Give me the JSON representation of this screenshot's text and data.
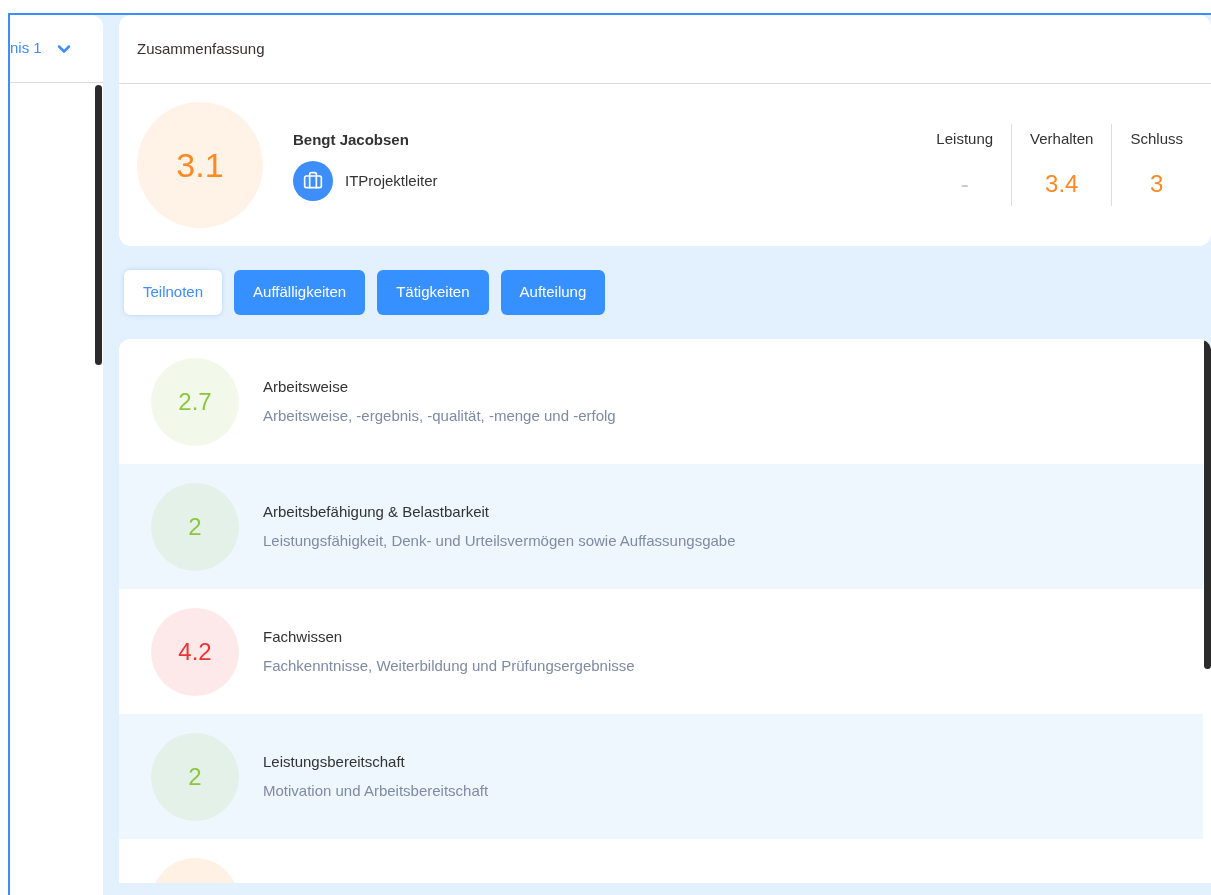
{
  "sidebar": {
    "dropdown_label": "nis 1"
  },
  "summary": {
    "title": "Zusammenfassung",
    "overall": {
      "score": "3.1",
      "color": "#fb8a24"
    },
    "name": "Bengt Jacobsen",
    "role": "ITProjektleiter",
    "grades": [
      {
        "label": "Leistung",
        "value": "-",
        "color": "#c8c8c8"
      },
      {
        "label": "Verhalten",
        "value": "3.4",
        "color": "#fb8a24"
      },
      {
        "label": "Schluss",
        "value": "3",
        "color": "#fb8a24"
      }
    ]
  },
  "tabs": [
    {
      "label": "Teilnoten",
      "selected": true
    },
    {
      "label": "Auffälligkeiten",
      "selected": false
    },
    {
      "label": "Tätigkeiten",
      "selected": false
    },
    {
      "label": "Aufteilung",
      "selected": false
    }
  ],
  "items": [
    {
      "score": "2.7",
      "color": "#8cc63f",
      "title": "Arbeitsweise",
      "subtitle": "Arbeitsweise, -ergebnis, -qualität, -menge und -erfolg"
    },
    {
      "score": "2",
      "color": "#8cc63f",
      "title": "Arbeitsbefähigung & Belastbarkeit",
      "subtitle": "Leistungsfähigkeit, Denk- und Urteilsvermögen sowie Auffassungsgabe"
    },
    {
      "score": "4.2",
      "color": "#ec3434",
      "title": "Fachwissen",
      "subtitle": "Fachkenntnisse, Weiterbildung und Prüfungsergebnisse"
    },
    {
      "score": "2",
      "color": "#8cc63f",
      "title": "Leistungsbereitschaft",
      "subtitle": "Motivation und Arbeitsbereitschaft"
    },
    {
      "color": "#fff1e3"
    }
  ]
}
